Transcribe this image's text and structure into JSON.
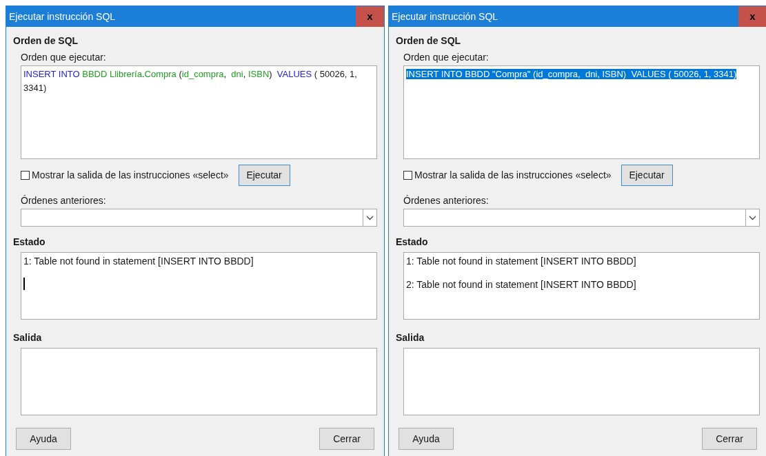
{
  "dialogs": [
    {
      "title": "Ejecutar instrucción SQL",
      "close": "x",
      "section_sql": "Orden de SQL",
      "command_label": "Orden que ejecutar:",
      "command": {
        "selected": false,
        "segments": [
          {
            "text": "INSERT INTO",
            "kind": "keyword"
          },
          {
            "text": " BBDD Llibrería",
            "kind": "identifier"
          },
          {
            "text": ".",
            "kind": "plain"
          },
          {
            "text": "Compra",
            "kind": "identifier"
          },
          {
            "text": " (",
            "kind": "plain"
          },
          {
            "text": "id_compra",
            "kind": "identifier"
          },
          {
            "text": ",  ",
            "kind": "plain"
          },
          {
            "text": "dni",
            "kind": "identifier"
          },
          {
            "text": ", ",
            "kind": "plain"
          },
          {
            "text": "ISBN",
            "kind": "identifier"
          },
          {
            "text": ")  ",
            "kind": "plain"
          },
          {
            "text": "VALUES",
            "kind": "keyword"
          },
          {
            "text": " ( 50026, 1, 3341)",
            "kind": "plain"
          }
        ]
      },
      "show_output": {
        "label": "Mostrar la salida de las instrucciones «select»",
        "checked": false
      },
      "execute_button": "Ejecutar",
      "previous_label": "Órdenes anteriores:",
      "section_status": "Estado",
      "status_messages": [
        "1: Table not found in statement [INSERT INTO BBDD]"
      ],
      "status_caret": true,
      "section_output": "Salida",
      "help_button": "Ayuda",
      "close_button": "Cerrar"
    },
    {
      "title": "Ejecutar instrucción SQL",
      "close": "x",
      "section_sql": "Orden de SQL",
      "command_label": "Orden que ejecutar:",
      "command": {
        "selected": true,
        "segments": [
          {
            "text": "INSERT INTO BBDD \"Compra\" (id_compra,  dni, ISBN)  VALUES ( 50026, 1, 3341)"
          }
        ]
      },
      "show_output": {
        "label": "Mostrar la salida de las instrucciones «select»",
        "checked": false
      },
      "execute_button": "Ejecutar",
      "previous_label": "Órdenes anteriores:",
      "section_status": "Estado",
      "status_messages": [
        "1: Table not found in statement [INSERT INTO BBDD]",
        "2: Table not found in statement [INSERT INTO BBDD]"
      ],
      "status_caret": false,
      "section_output": "Salida",
      "help_button": "Ayuda",
      "close_button": "Cerrar"
    }
  ]
}
